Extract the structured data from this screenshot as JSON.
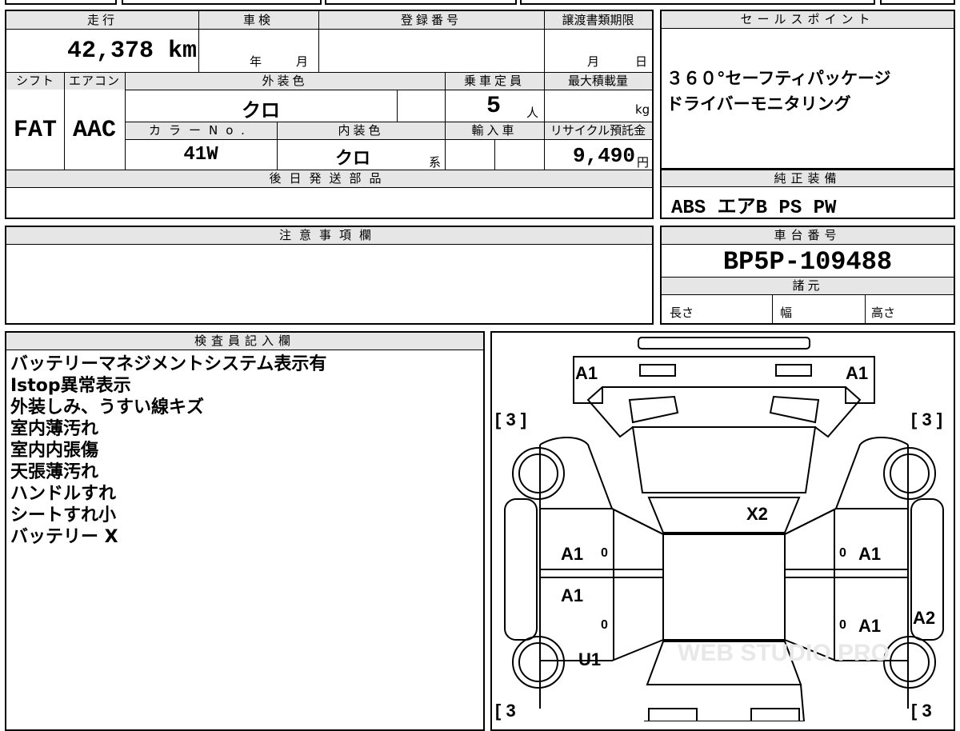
{
  "spec": {
    "mileage_label": "走行",
    "mileage_value": "42,378 km",
    "shaken_label": "車検",
    "shaken_year": "年",
    "shaken_month": "月",
    "reg_label": "登録番号",
    "transfer_label": "譲渡書類期限",
    "transfer_month": "月",
    "transfer_day": "日",
    "shift_label": "シフト",
    "shift_value": "FAT",
    "ac_label": "エアコン",
    "ac_value": "AAC",
    "ext_color_label": "外装色",
    "ext_color_value": "クロ",
    "capacity_label": "乗車定員",
    "capacity_value": "5",
    "capacity_unit": "人",
    "load_label": "最大積載量",
    "load_unit": "kg",
    "colorno_label": "カラーNo.",
    "colorno_value": "41W",
    "int_color_label": "内装色",
    "int_color_value": "クロ",
    "int_color_suffix": "系",
    "import_label": "輸入車",
    "recycle_label": "リサイクル預託金",
    "recycle_value": "9,490",
    "recycle_unit": "円",
    "later_parts_label": "後日発送部品"
  },
  "sales": {
    "label": "セールスポイント",
    "lines": [
      "３６０°セーフティパッケージ",
      "ドライバーモニタリング"
    ]
  },
  "equipment": {
    "label": "純正装備",
    "value": "ABS エアB PS PW"
  },
  "caution": {
    "label": "注意事項欄"
  },
  "chassis": {
    "label": "車台番号",
    "value": "BP5P-109488",
    "specs_label": "諸元",
    "length_label": "長さ",
    "width_label": "幅",
    "height_label": "高さ"
  },
  "inspector": {
    "label": "検査員記入欄",
    "notes": [
      "バッテリーマネジメントシステム表示有",
      "Istop異常表示",
      "外装しみ、うすい線キズ",
      "室内薄汚れ",
      "室内内張傷",
      "天張薄汚れ",
      "ハンドルすれ",
      "シートすれ小",
      "バッテリー X"
    ]
  },
  "diagram": {
    "front_left": "A1",
    "front_right": "A1",
    "bracket_tl": "[ 3 ]",
    "bracket_tr": "[ 3 ]",
    "bracket_bl": "[ 3",
    "bracket_br": "[ 3",
    "roof": "X2",
    "left_front_door": "A1",
    "left_rear_door": "A1",
    "right_front_door": "A1",
    "right_rear_door": "A1",
    "right_rear_fender": "A2",
    "left_rear_fender": "U1",
    "zero": "0",
    "watermark": "WEB STUDIO PRO"
  }
}
